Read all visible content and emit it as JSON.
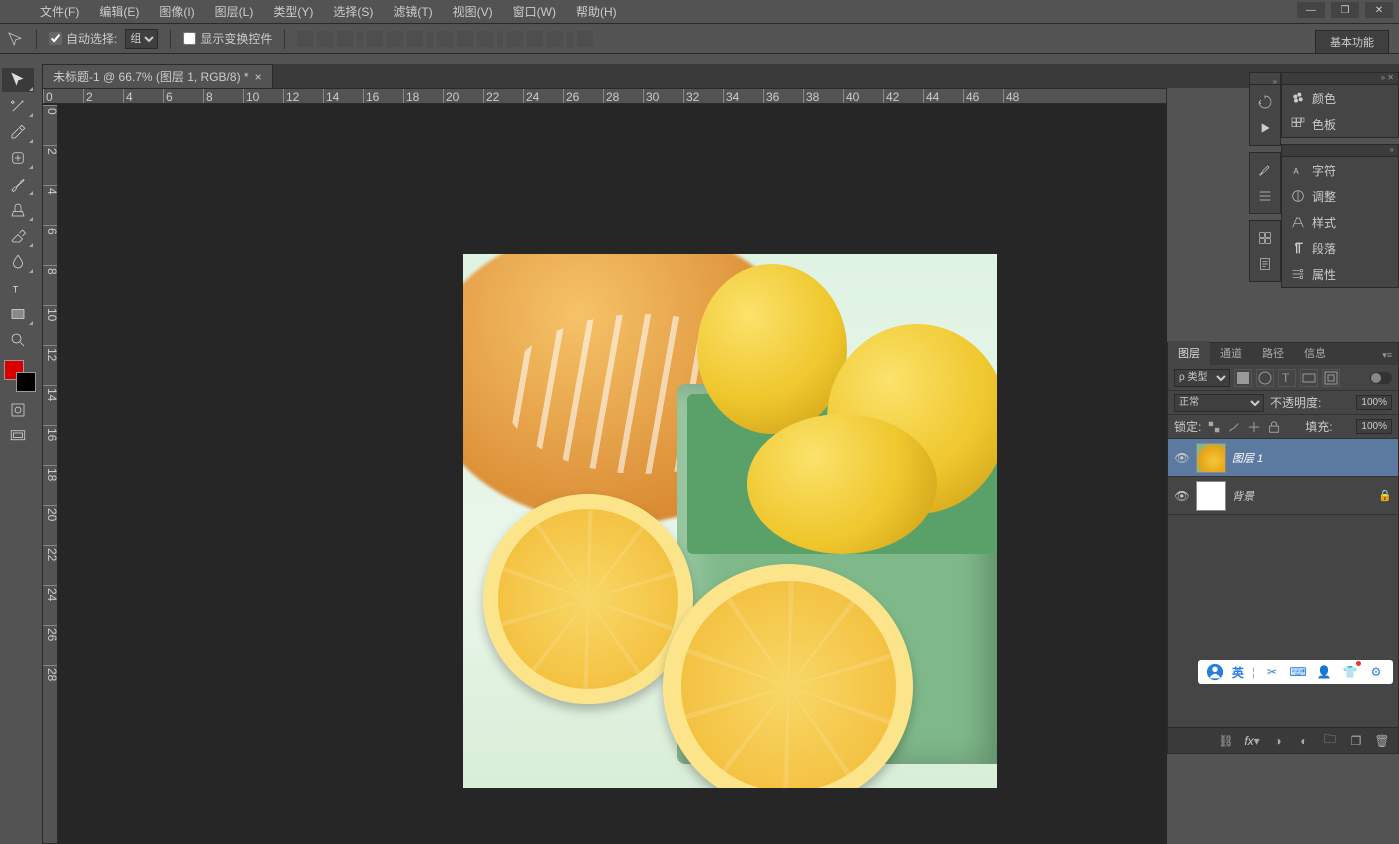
{
  "menu": [
    "文件(F)",
    "编辑(E)",
    "图像(I)",
    "图层(L)",
    "类型(Y)",
    "选择(S)",
    "滤镜(T)",
    "视图(V)",
    "窗口(W)",
    "帮助(H)"
  ],
  "options_bar": {
    "auto_select_label": "自动选择:",
    "auto_select_value": "组",
    "show_transform_label": "显示变换控件"
  },
  "workspace_label": "基本功能",
  "document_tab": "未标题-1 @ 66.7% (图层 1, RGB/8) *",
  "ruler_h": [
    "0",
    "2",
    "4",
    "6",
    "8",
    "10",
    "12",
    "14",
    "16",
    "18",
    "20",
    "22",
    "24",
    "26",
    "28",
    "30",
    "32",
    "34",
    "36",
    "38",
    "40",
    "42",
    "44",
    "46",
    "48"
  ],
  "ruler_v": [
    "0",
    "2",
    "4",
    "6",
    "8",
    "10",
    "12",
    "14",
    "16",
    "18",
    "20",
    "22",
    "24",
    "26",
    "28"
  ],
  "tools": [
    "move",
    "wand",
    "eyedrop",
    "heal",
    "brush",
    "stamp",
    "eraser",
    "blur",
    "type",
    "rect",
    "zoom"
  ],
  "swatch": {
    "fg": "#d90000",
    "bg": "#000000"
  },
  "right_collapsed_1": [
    "颜色",
    "色板"
  ],
  "right_collapsed_2": [
    "字符",
    "调整",
    "样式",
    "段落",
    "属性"
  ],
  "layers_panel": {
    "tabs": [
      "图层",
      "通道",
      "路径",
      "信息"
    ],
    "filter_kind": "ρ 类型",
    "blend_mode": "正常",
    "opacity_label": "不透明度:",
    "opacity_value": "100%",
    "lock_label": "锁定:",
    "fill_label": "填充:",
    "fill_value": "100%",
    "layers": [
      {
        "name": "图层 1",
        "thumb": "photo",
        "selected": true,
        "locked": false
      },
      {
        "name": "背景",
        "thumb": "white",
        "selected": false,
        "locked": true
      }
    ]
  },
  "tray": {
    "ime": "英"
  }
}
